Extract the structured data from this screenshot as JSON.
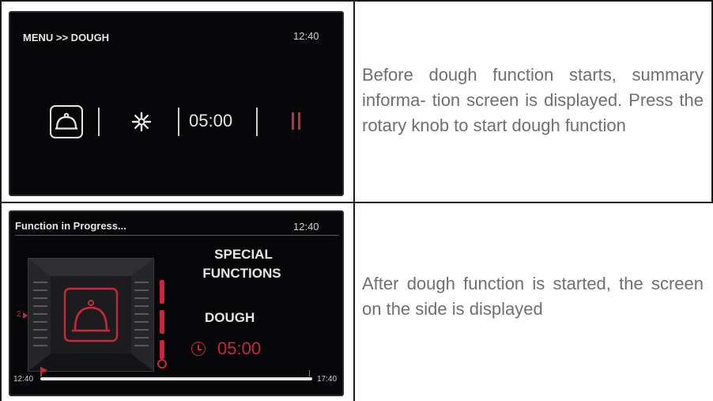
{
  "rows": [
    {
      "screen": {
        "breadcrumb": "MENU >> DOUGH",
        "time": "12:40",
        "icons": [
          "dough-bell-icon",
          "fan-icon",
          "pause-icon"
        ],
        "duration": "05:00"
      },
      "description": "Before dough function starts, summary informa- tion screen is displayed. Press the rotary knob to start dough function"
    },
    {
      "screen": {
        "status": "Function in Progress...",
        "time": "12:40",
        "category_line1": "SPECIAL",
        "category_line2": "FUNCTIONS",
        "function_name": "DOUGH",
        "timer": "05:00",
        "shelf_level": "2",
        "start_time": "12:40",
        "end_time": "17:40",
        "progress": 0.05
      },
      "description": "After dough function is started, the screen on the side is displayed"
    }
  ],
  "colors": {
    "accent_red": "#c8283c",
    "screen_bg": "#070709",
    "description_text": "#6f6f6f"
  }
}
